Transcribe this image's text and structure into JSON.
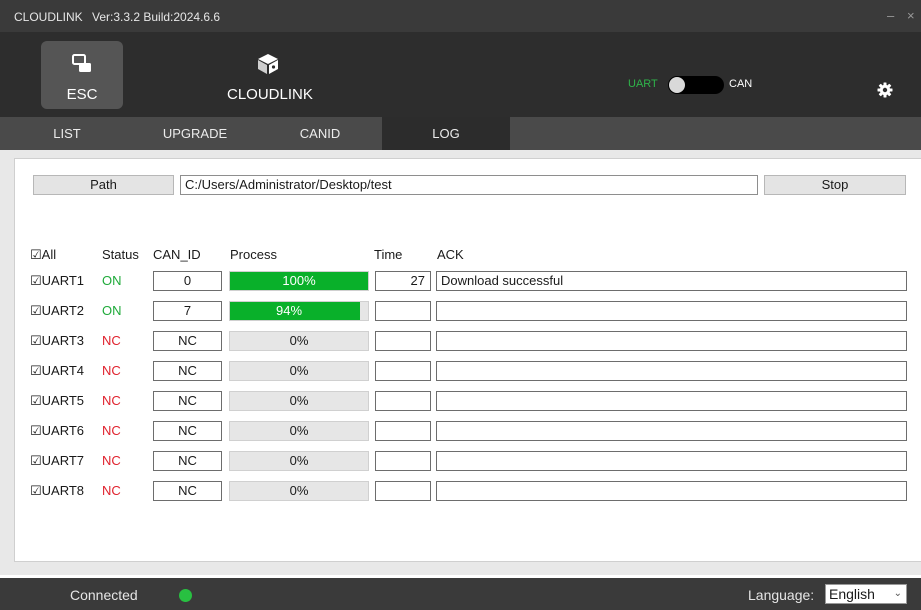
{
  "titlebar": {
    "app_name": "CLOUDLINK",
    "version": "Ver:3.3.2  Build:2024.6.6",
    "minimize": "–",
    "close": "×"
  },
  "modes": {
    "esc_label": "ESC",
    "cloudlink_label": "CLOUDLINK"
  },
  "switch": {
    "left_label": "UART",
    "right_label": "CAN",
    "state": "UART"
  },
  "tabs": [
    "LIST",
    "UPGRADE",
    "CANID",
    "LOG"
  ],
  "active_tab": "LOG",
  "path": {
    "button_label": "Path",
    "value": "C:/Users/Administrator/Desktop/test",
    "stop_label": "Stop"
  },
  "table": {
    "headers": {
      "all": "☑All",
      "status": "Status",
      "can_id": "CAN_ID",
      "process": "Process",
      "time": "Time",
      "ack": "ACK"
    },
    "rows": [
      {
        "label": "☑UART1",
        "status": "ON",
        "can_id": "0",
        "progress": 100,
        "progress_text": "100%",
        "time": "27",
        "ack": "Download successful"
      },
      {
        "label": "☑UART2",
        "status": "ON",
        "can_id": "7",
        "progress": 94,
        "progress_text": "94%",
        "time": "",
        "ack": ""
      },
      {
        "label": "☑UART3",
        "status": "NC",
        "can_id": "NC",
        "progress": 0,
        "progress_text": "0%",
        "time": "",
        "ack": ""
      },
      {
        "label": "☑UART4",
        "status": "NC",
        "can_id": "NC",
        "progress": 0,
        "progress_text": "0%",
        "time": "",
        "ack": ""
      },
      {
        "label": "☑UART5",
        "status": "NC",
        "can_id": "NC",
        "progress": 0,
        "progress_text": "0%",
        "time": "",
        "ack": ""
      },
      {
        "label": "☑UART6",
        "status": "NC",
        "can_id": "NC",
        "progress": 0,
        "progress_text": "0%",
        "time": "",
        "ack": ""
      },
      {
        "label": "☑UART7",
        "status": "NC",
        "can_id": "NC",
        "progress": 0,
        "progress_text": "0%",
        "time": "",
        "ack": ""
      },
      {
        "label": "☑UART8",
        "status": "NC",
        "can_id": "NC",
        "progress": 0,
        "progress_text": "0%",
        "time": "",
        "ack": ""
      }
    ]
  },
  "statusbar": {
    "connection": "Connected",
    "language_label": "Language:",
    "language_value": "English"
  },
  "colors": {
    "on": "#1faa3a",
    "nc": "#e0212d",
    "progress_fill": "#09b02a",
    "connected_dot": "#28c041"
  },
  "icons": {
    "esc": "esc-layers-icon",
    "cloudlink": "cloudlink-box-icon",
    "settings": "gear-icon"
  }
}
